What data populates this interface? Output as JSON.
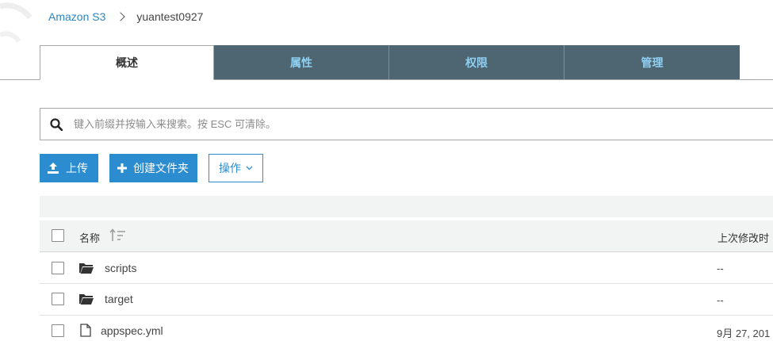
{
  "breadcrumb": {
    "root": "Amazon S3",
    "current": "yuantest0927"
  },
  "tabs": [
    {
      "label": "概述",
      "active": true
    },
    {
      "label": "属性",
      "active": false
    },
    {
      "label": "权限",
      "active": false
    },
    {
      "label": "管理",
      "active": false
    }
  ],
  "search": {
    "placeholder": "键入前缀并按输入来搜索。按 ESC 可清除。",
    "value": ""
  },
  "actions": {
    "upload_label": "上传",
    "create_folder_label": "创建文件夹",
    "actions_label": "操作"
  },
  "table": {
    "columns": {
      "name": "名称",
      "last_modified": "上次修改时"
    },
    "rows": [
      {
        "type": "folder",
        "name": "scripts",
        "last_modified": "--"
      },
      {
        "type": "folder",
        "name": "target",
        "last_modified": "--"
      },
      {
        "type": "file",
        "name": "appspec.yml",
        "last_modified": "9月 27, 201"
      }
    ]
  },
  "colors": {
    "accent": "#2b8cd0",
    "tab_background": "#4e6572",
    "tab_text": "#8fd0f2",
    "link": "#2e86c1"
  },
  "icons": {
    "search": "search-icon",
    "upload": "upload-icon",
    "create_folder": "plus-icon",
    "dropdown": "chevron-down-icon",
    "sort": "sort-icon",
    "folder": "folder-icon",
    "file": "file-icon"
  }
}
